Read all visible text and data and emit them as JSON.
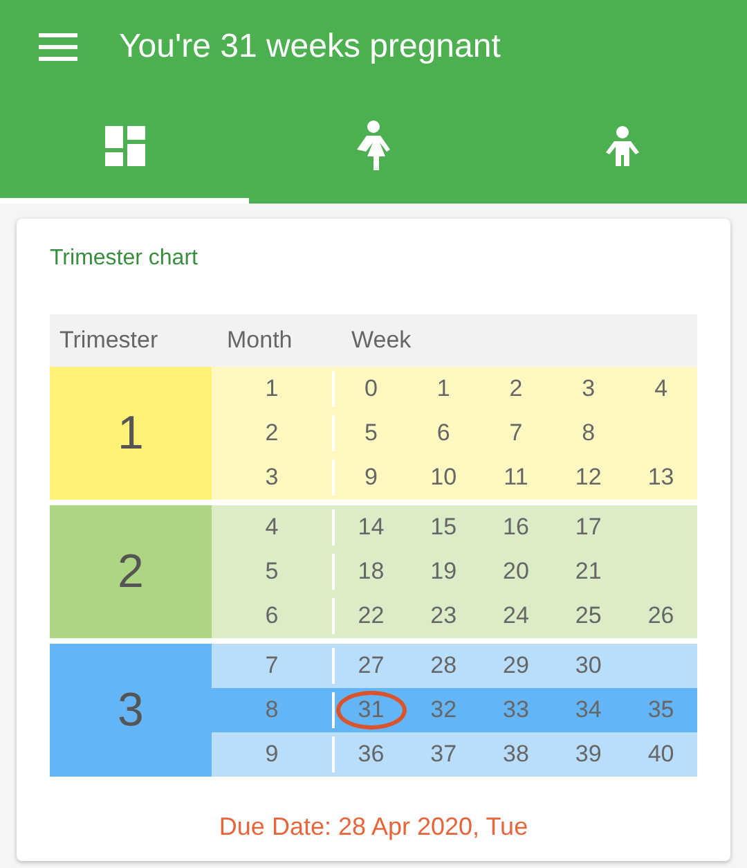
{
  "app_bar": {
    "title": "You're 31 weeks pregnant"
  },
  "tabs": [
    {
      "kind": "dashboard",
      "selected": true
    },
    {
      "kind": "woman",
      "selected": false
    },
    {
      "kind": "child",
      "selected": false
    }
  ],
  "card": {
    "title": "Trimester chart",
    "columns": [
      "Trimester",
      "Month",
      "Week"
    ],
    "trimesters": [
      {
        "label": "1",
        "color": "#fff176",
        "months": [
          {
            "month": "1",
            "selected": false,
            "weeks": [
              {
                "label": "0",
                "circled": false
              },
              {
                "label": "1",
                "circled": false
              },
              {
                "label": "2",
                "circled": false
              },
              {
                "label": "3",
                "circled": false
              },
              {
                "label": "4",
                "circled": false
              }
            ]
          },
          {
            "month": "2",
            "selected": false,
            "weeks": [
              {
                "label": "5",
                "circled": false
              },
              {
                "label": "6",
                "circled": false
              },
              {
                "label": "7",
                "circled": false
              },
              {
                "label": "8",
                "circled": false
              }
            ]
          },
          {
            "month": "3",
            "selected": false,
            "weeks": [
              {
                "label": "9",
                "circled": false
              },
              {
                "label": "10",
                "circled": false
              },
              {
                "label": "11",
                "circled": false
              },
              {
                "label": "12",
                "circled": false
              },
              {
                "label": "13",
                "circled": false
              }
            ]
          }
        ]
      },
      {
        "label": "2",
        "color": "#aed581",
        "months": [
          {
            "month": "4",
            "selected": false,
            "weeks": [
              {
                "label": "14",
                "circled": false
              },
              {
                "label": "15",
                "circled": false
              },
              {
                "label": "16",
                "circled": false
              },
              {
                "label": "17",
                "circled": false
              }
            ]
          },
          {
            "month": "5",
            "selected": false,
            "weeks": [
              {
                "label": "18",
                "circled": false
              },
              {
                "label": "19",
                "circled": false
              },
              {
                "label": "20",
                "circled": false
              },
              {
                "label": "21",
                "circled": false
              }
            ]
          },
          {
            "month": "6",
            "selected": false,
            "weeks": [
              {
                "label": "22",
                "circled": false
              },
              {
                "label": "23",
                "circled": false
              },
              {
                "label": "24",
                "circled": false
              },
              {
                "label": "25",
                "circled": false
              },
              {
                "label": "26",
                "circled": false
              }
            ]
          }
        ]
      },
      {
        "label": "3",
        "color": "#64b5f6",
        "months": [
          {
            "month": "7",
            "selected": false,
            "weeks": [
              {
                "label": "27",
                "circled": false
              },
              {
                "label": "28",
                "circled": false
              },
              {
                "label": "29",
                "circled": false
              },
              {
                "label": "30",
                "circled": false
              }
            ]
          },
          {
            "month": "8",
            "selected": true,
            "weeks": [
              {
                "label": "31",
                "circled": true
              },
              {
                "label": "32",
                "circled": false
              },
              {
                "label": "33",
                "circled": false
              },
              {
                "label": "34",
                "circled": false
              },
              {
                "label": "35",
                "circled": false
              }
            ]
          },
          {
            "month": "9",
            "selected": false,
            "weeks": [
              {
                "label": "36",
                "circled": false
              },
              {
                "label": "37",
                "circled": false
              },
              {
                "label": "38",
                "circled": false
              },
              {
                "label": "39",
                "circled": false
              },
              {
                "label": "40",
                "circled": false
              }
            ]
          }
        ]
      }
    ],
    "due_date": "Due Date: 28 Apr 2020, Tue"
  }
}
